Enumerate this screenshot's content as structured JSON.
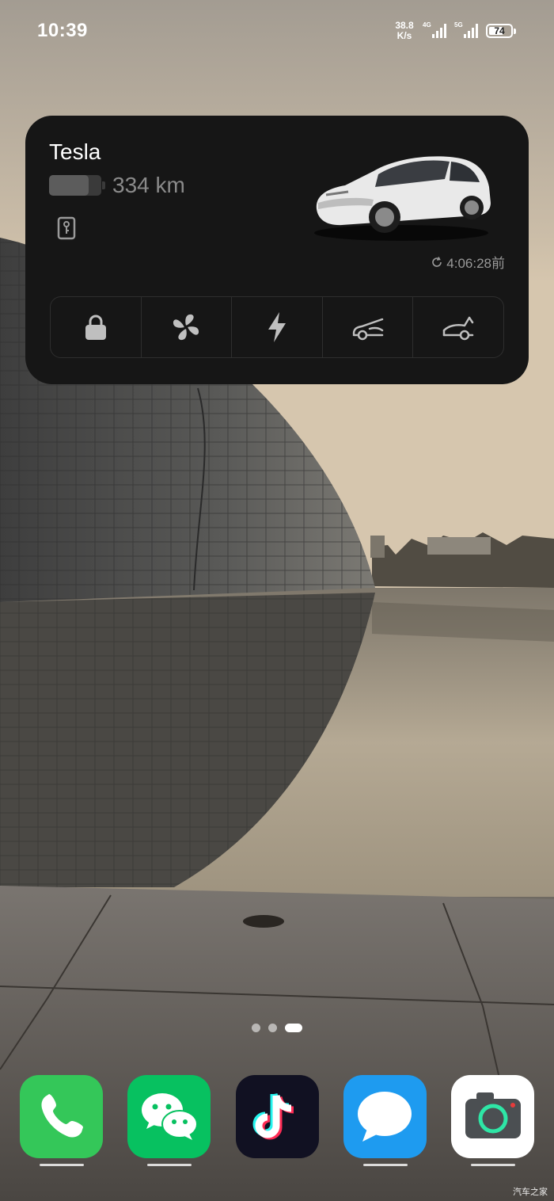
{
  "status_bar": {
    "time": "10:39",
    "net_speed_value": "38.8",
    "net_speed_unit": "K/s",
    "signal_1_label": "4G",
    "signal_2_label": "5G",
    "battery_percent": "74",
    "battery_level": 0.74
  },
  "widget": {
    "car_name": "Tesla",
    "range": "334 km",
    "battery_level": 0.75,
    "last_updated": "4:06:28前",
    "actions": [
      {
        "name": "lock",
        "icon": "lock-icon"
      },
      {
        "name": "climate",
        "icon": "fan-icon"
      },
      {
        "name": "charge",
        "icon": "lightning-icon"
      },
      {
        "name": "frunk",
        "icon": "frunk-icon"
      },
      {
        "name": "trunk",
        "icon": "trunk-icon"
      }
    ]
  },
  "page_indicator": {
    "count": 3,
    "active_index": 2
  },
  "dock": {
    "apps": [
      {
        "icon": "phone-icon"
      },
      {
        "icon": "wechat-icon"
      },
      {
        "icon": "tiktok-icon"
      },
      {
        "icon": "messages-icon"
      },
      {
        "icon": "camera-icon"
      }
    ]
  },
  "watermark": "汽车之家",
  "colors": {
    "widget_bg": "#161616",
    "phone_green": "#34c759",
    "wechat_green": "#07c160",
    "messages_blue": "#1e9bf0",
    "tiktok_bg": "#111122"
  }
}
